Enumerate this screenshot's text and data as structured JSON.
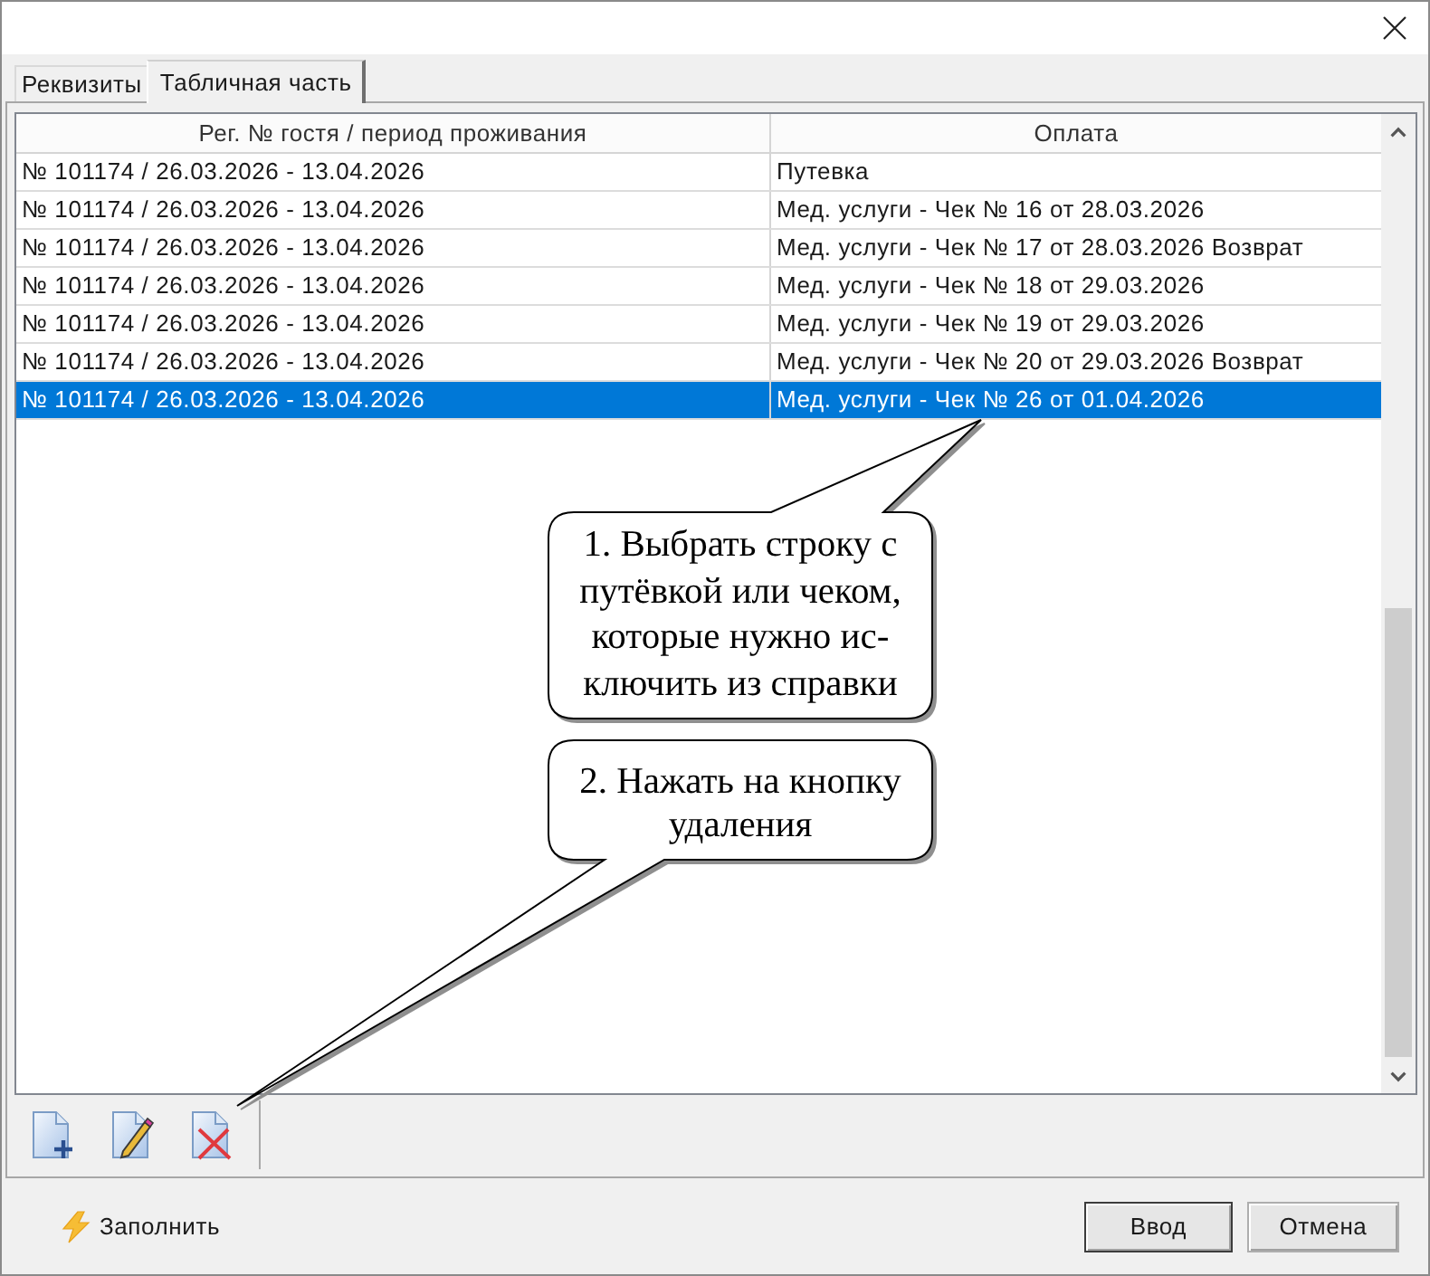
{
  "tabs": [
    {
      "label": "Реквизиты",
      "selected": false
    },
    {
      "label": "Табличная часть",
      "selected": true
    }
  ],
  "table": {
    "columns": [
      "Рег. № гостя / период проживания",
      "Оплата"
    ],
    "rows": [
      {
        "cells": [
          "№ 101174 / 26.03.2026 - 13.04.2026",
          "Путевка"
        ],
        "selected": false
      },
      {
        "cells": [
          "№ 101174 / 26.03.2026 - 13.04.2026",
          "Мед. услуги - Чек № 16 от 28.03.2026"
        ],
        "selected": false
      },
      {
        "cells": [
          "№ 101174 / 26.03.2026 - 13.04.2026",
          "Мед. услуги - Чек № 17 от 28.03.2026 Возврат"
        ],
        "selected": false
      },
      {
        "cells": [
          "№ 101174 / 26.03.2026 - 13.04.2026",
          "Мед. услуги - Чек № 18 от 29.03.2026"
        ],
        "selected": false
      },
      {
        "cells": [
          "№ 101174 / 26.03.2026 - 13.04.2026",
          "Мед. услуги - Чек № 19 от 29.03.2026"
        ],
        "selected": false
      },
      {
        "cells": [
          "№ 101174 / 26.03.2026 - 13.04.2026",
          "Мед. услуги - Чек № 20 от 29.03.2026 Возврат"
        ],
        "selected": false
      },
      {
        "cells": [
          "№ 101174 / 26.03.2026 - 13.04.2026",
          "Мед. услуги - Чек № 26 от 01.04.2026"
        ],
        "selected": true
      }
    ]
  },
  "footer": {
    "fill_button": "Заполнить",
    "buttons": [
      {
        "label": "Ввод",
        "default": true
      },
      {
        "label": "Отмена",
        "default": false
      }
    ]
  },
  "callouts": [
    {
      "lines": [
        "1. Выбрать строку с",
        "путёвкой или чеком,",
        "которые нужно ис-",
        "ключить из справки"
      ]
    },
    {
      "lines": [
        "2. Нажать на кнопку",
        "удаления"
      ]
    }
  ]
}
